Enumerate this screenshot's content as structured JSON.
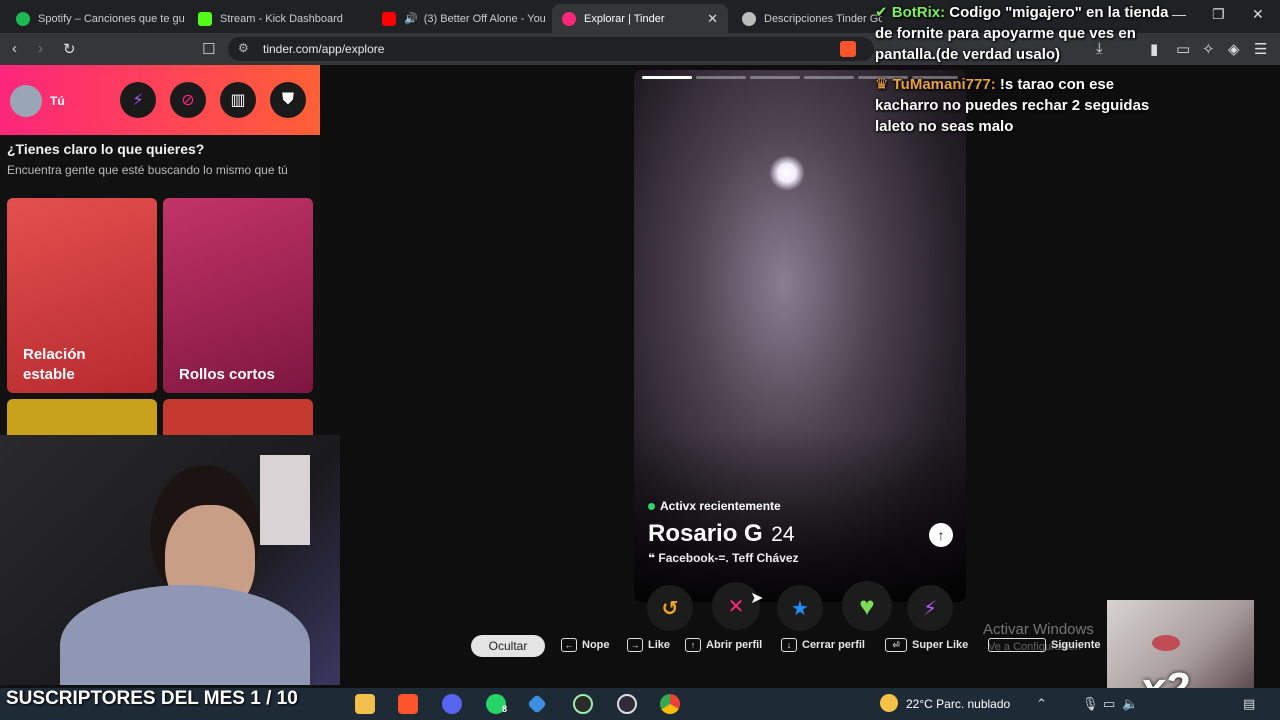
{
  "browser": {
    "tabs": [
      {
        "title": "Spotify – Canciones que te gu",
        "favicon_color": "#1db954"
      },
      {
        "title": "Stream - Kick Dashboard",
        "favicon_color": "#53fc18"
      },
      {
        "title": "(3) Better Off Alone - You",
        "favicon_color": "#ff0000"
      },
      {
        "title": "Explorar | Tinder",
        "favicon_color": "#fd267a",
        "active": true
      },
      {
        "title": "Descripciones Tinder Go",
        "favicon_color": "#bbbbbb"
      }
    ],
    "url": "tinder.com/app/explore"
  },
  "sidebar": {
    "user_label": "Tú",
    "icons": [
      "bolt-icon",
      "compass-icon",
      "briefcase-icon",
      "shield-icon"
    ],
    "heading": "¿Tienes claro lo que quieres?",
    "subheading": "Encuentra gente que esté buscando lo mismo que tú",
    "cards": [
      {
        "label": "Relación estable",
        "color": "#d9393c"
      },
      {
        "label": "Rollos cortos",
        "color": "#a62152"
      },
      {
        "label": "",
        "color": "#c9a21b"
      },
      {
        "label": "",
        "color": "#c53a2f"
      }
    ]
  },
  "profile": {
    "status": "Activx recientemente",
    "name": "Rosario G",
    "age": "24",
    "bio": "Facebook-=. Teff Chávez",
    "photo_count": 6,
    "active_photo": 1
  },
  "actions": [
    {
      "name": "rewind",
      "glyph": "↺",
      "color": "#f5a623"
    },
    {
      "name": "nope",
      "glyph": "✕",
      "color": "#fd267a"
    },
    {
      "name": "super-like",
      "glyph": "★",
      "color": "#1f8fff"
    },
    {
      "name": "like",
      "glyph": "♥",
      "color": "#7ed957"
    },
    {
      "name": "boost",
      "glyph": "⚡",
      "color": "#b25bff"
    }
  ],
  "hints": {
    "hide": "Ocultar",
    "nope": "Nope",
    "like": "Like",
    "open_profile": "Abrir perfil",
    "close_profile": "Cerrar perfil",
    "super_like": "Super Like",
    "next": "Siguiente"
  },
  "windows_watermark": {
    "line1": "Activar Windows",
    "line2": "Ve a Configuración"
  },
  "chat": [
    {
      "user": "BotRix:",
      "user_color": "#7cf05a",
      "text": "Codigo \"migajero\" en la tienda de fornite para apoyarme que ves en pantalla.(de verdad usalo)"
    },
    {
      "user": "TuMamani777:",
      "user_color": "#e8a23b",
      "text": "!s tarao con ese kacharro no puedes rechar 2 seguidas laleto no seas malo"
    }
  ],
  "overlay": {
    "subs_banner": "SUSCRIPTORES DEL MES 1 / 10",
    "multiplier": "x2"
  },
  "taskbar": {
    "weather": "22°C  Parc. nublado",
    "whatsapp_badge": "8"
  }
}
